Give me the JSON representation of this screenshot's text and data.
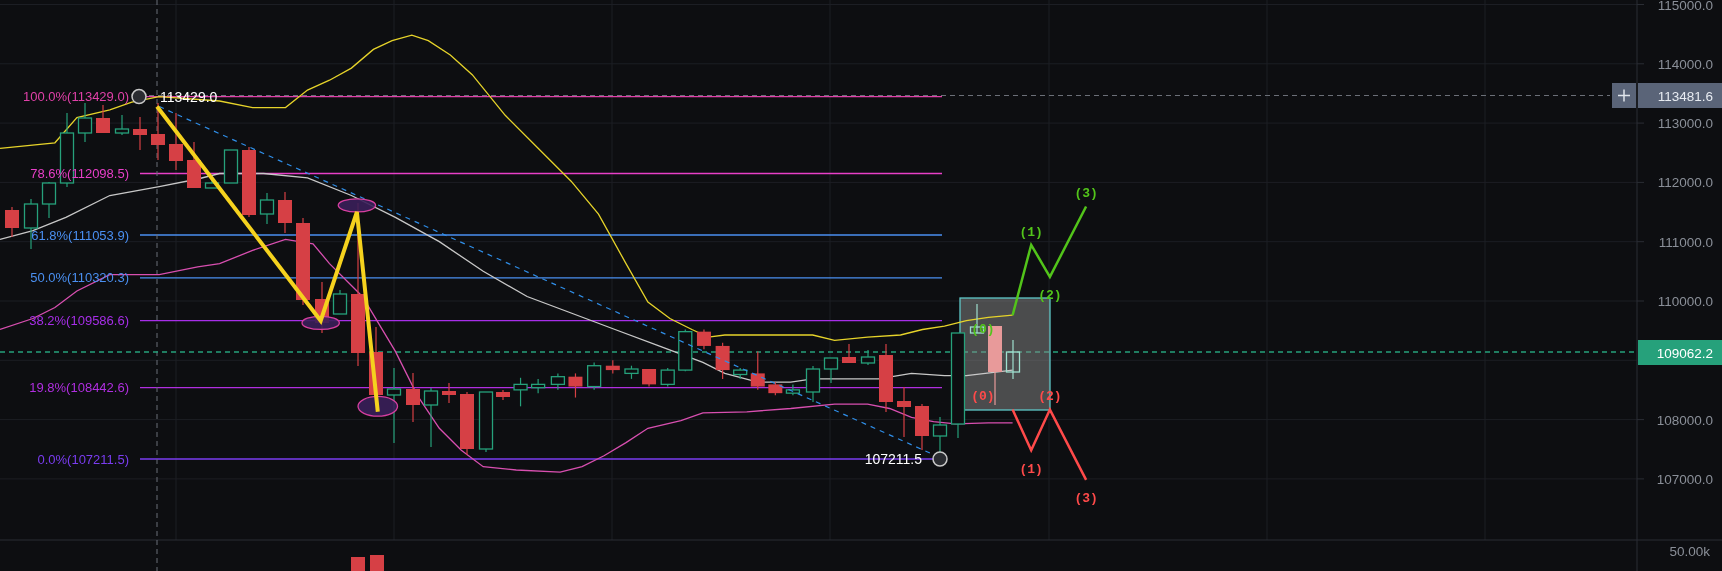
{
  "price_axis": {
    "labels": [
      "115000.0",
      "114000.0",
      "113000.0",
      "112000.0",
      "111000.0",
      "110000.0",
      "108000.0",
      "107000.0"
    ]
  },
  "crosshair": {
    "price": "113481.6"
  },
  "last_price": {
    "price": "109062.2"
  },
  "fib_levels": [
    {
      "label": "100.0%(113429.0)",
      "color": "#e040a8"
    },
    {
      "label": "78.6%(112098.5)",
      "color": "#e83fc8"
    },
    {
      "label": "61.8%(111053.9)",
      "color": "#4a8ff0"
    },
    {
      "label": "50.0%(110320.3)",
      "color": "#4a8ff0"
    },
    {
      "label": "38.2%(109586.6)",
      "color": "#a62ee8"
    },
    {
      "label": "19.8%(108442.6)",
      "color": "#b02ee0"
    },
    {
      "label": "0.0%(107211.5)",
      "color": "#7a3cf0"
    }
  ],
  "price_markers": [
    {
      "kind": "high",
      "value": "113429.0"
    },
    {
      "kind": "low",
      "value": "107211.5"
    }
  ],
  "bullish_scenario": {
    "labels": [
      "(0)",
      "(1)",
      "(2)",
      "(3)"
    ]
  },
  "bearish_scenario": {
    "labels": [
      "(0)",
      "(1)",
      "(2)",
      "(3)"
    ]
  },
  "volume_axis": {
    "label": "50.00k"
  }
}
